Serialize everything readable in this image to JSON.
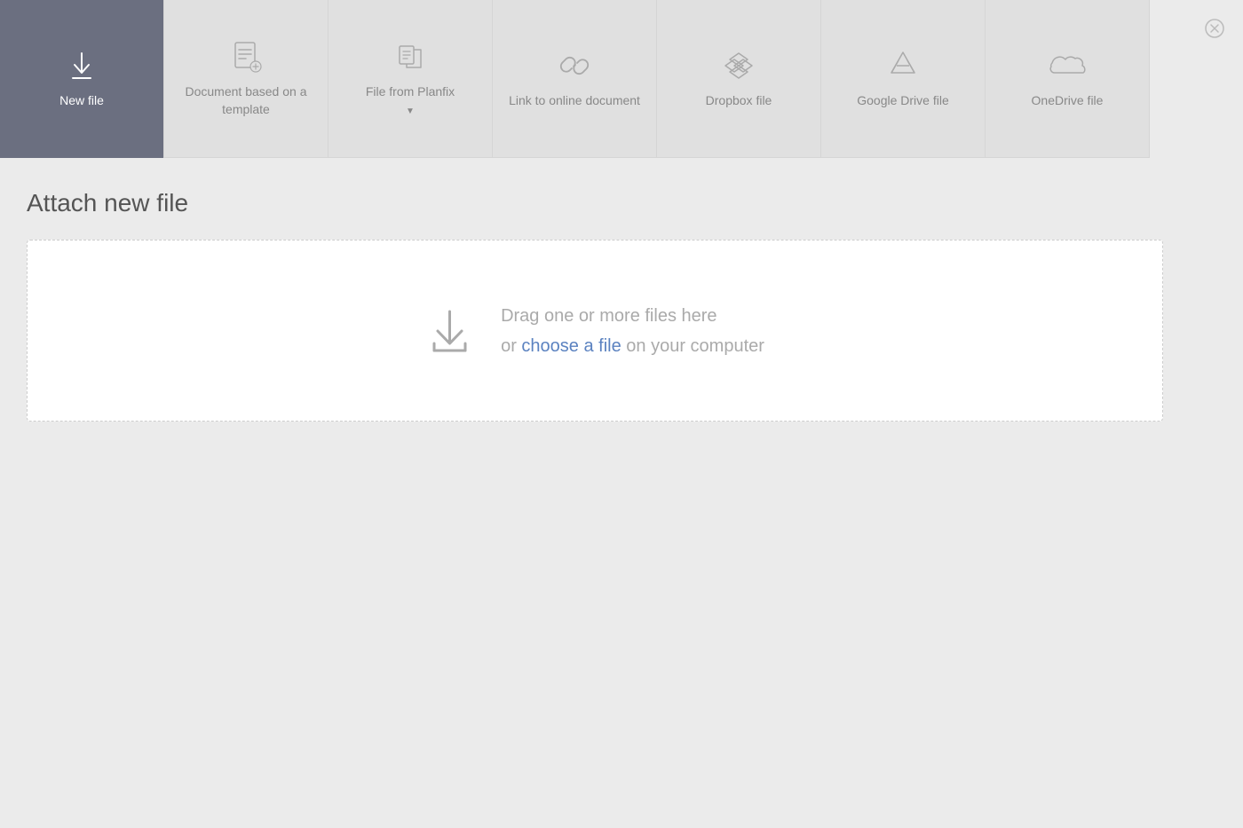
{
  "dialog": {
    "close_label": "✕"
  },
  "tabs": [
    {
      "id": "new-file",
      "label": "New file",
      "active": true,
      "icon": "download-icon",
      "has_arrow": false
    },
    {
      "id": "document-template",
      "label": "Document based on a template",
      "active": false,
      "icon": "document-template-icon",
      "has_arrow": false
    },
    {
      "id": "file-from-planfix",
      "label": "File from Planfix",
      "active": false,
      "icon": "planfix-icon",
      "has_arrow": true
    },
    {
      "id": "link-online",
      "label": "Link to online document",
      "active": false,
      "icon": "link-icon",
      "has_arrow": false
    },
    {
      "id": "dropbox",
      "label": "Dropbox file",
      "active": false,
      "icon": "dropbox-icon",
      "has_arrow": false
    },
    {
      "id": "google-drive",
      "label": "Google Drive file",
      "active": false,
      "icon": "google-drive-icon",
      "has_arrow": false
    },
    {
      "id": "onedrive",
      "label": "OneDrive file",
      "active": false,
      "icon": "onedrive-icon",
      "has_arrow": false
    }
  ],
  "content": {
    "section_title": "Attach new file",
    "drop_zone": {
      "main_text": "Drag one or more files here",
      "link_text": "choose a file",
      "suffix_text": " on your computer",
      "prefix_text": "or "
    }
  }
}
